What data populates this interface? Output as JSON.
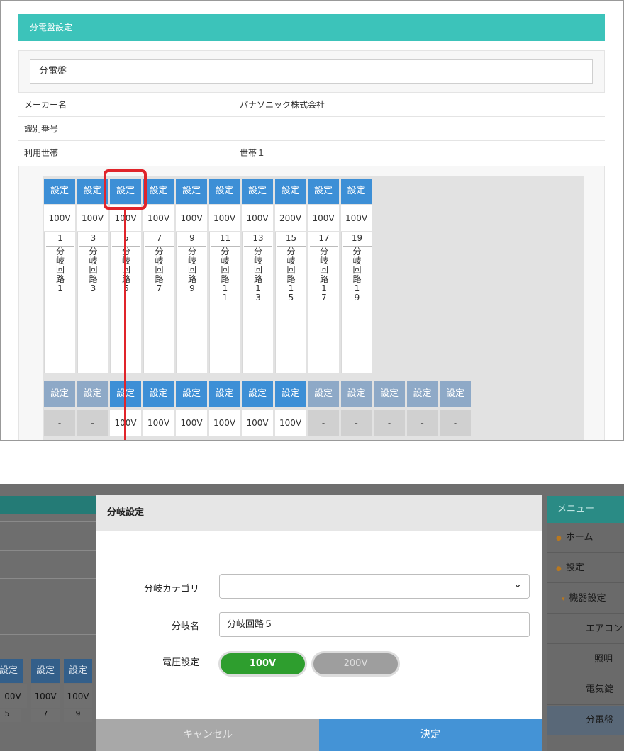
{
  "top": {
    "header_title": "分電盤設定",
    "board_name": "分電盤",
    "info_rows": [
      {
        "label": "メーカー名",
        "value": "パナソニック株式会社"
      },
      {
        "label": "識別番号",
        "value": ""
      },
      {
        "label": "利用世帯",
        "value": "世帯１"
      }
    ],
    "row1": [
      {
        "btn": "設定",
        "volt": "100V",
        "num": "1",
        "name": "分岐回路1"
      },
      {
        "btn": "設定",
        "volt": "100V",
        "num": "3",
        "name": "分岐回路3"
      },
      {
        "btn": "設定",
        "volt": "100V",
        "num": "5",
        "name": "分岐回路5"
      },
      {
        "btn": "設定",
        "volt": "100V",
        "num": "7",
        "name": "分岐回路7"
      },
      {
        "btn": "設定",
        "volt": "100V",
        "num": "9",
        "name": "分岐回路9"
      },
      {
        "btn": "設定",
        "volt": "100V",
        "num": "11",
        "name": "分岐回路11"
      },
      {
        "btn": "設定",
        "volt": "100V",
        "num": "13",
        "name": "分岐回路13"
      },
      {
        "btn": "設定",
        "volt": "200V",
        "num": "15",
        "name": "分岐回路15"
      },
      {
        "btn": "設定",
        "volt": "100V",
        "num": "17",
        "name": "分岐回路17"
      },
      {
        "btn": "設定",
        "volt": "100V",
        "num": "19",
        "name": "分岐回路19"
      }
    ],
    "row2": [
      {
        "btn": "設定",
        "volt": "-",
        "active": false
      },
      {
        "btn": "設定",
        "volt": "-",
        "active": false
      },
      {
        "btn": "設定",
        "volt": "100V",
        "active": true
      },
      {
        "btn": "設定",
        "volt": "100V",
        "active": true
      },
      {
        "btn": "設定",
        "volt": "100V",
        "active": true
      },
      {
        "btn": "設定",
        "volt": "100V",
        "active": true
      },
      {
        "btn": "設定",
        "volt": "100V",
        "active": true
      },
      {
        "btn": "設定",
        "volt": "100V",
        "active": true
      },
      {
        "btn": "設定",
        "volt": "-",
        "active": false
      },
      {
        "btn": "設定",
        "volt": "-",
        "active": false
      },
      {
        "btn": "設定",
        "volt": "-",
        "active": false
      },
      {
        "btn": "設定",
        "volt": "-",
        "active": false
      },
      {
        "btn": "設定",
        "volt": "-",
        "active": false
      }
    ]
  },
  "bottom": {
    "bg_buttons": [
      "設定",
      "設定",
      "設定"
    ],
    "bg_volts": [
      "00V",
      "100V",
      "100V"
    ],
    "bg_nums": [
      "5",
      "7",
      "9"
    ],
    "menu": {
      "title": "メニュー",
      "items": [
        {
          "label": "ホーム",
          "icon": "home-icon"
        },
        {
          "label": "設定",
          "icon": "gear-icon"
        },
        {
          "label": "機器設定",
          "icon": "chevron-down-icon"
        },
        {
          "label": "エアコン",
          "icon": ""
        },
        {
          "label": "照明",
          "icon": ""
        },
        {
          "label": "電気錠",
          "icon": ""
        },
        {
          "label": "分電盤",
          "icon": ""
        }
      ]
    },
    "modal": {
      "title": "分岐設定",
      "category_label": "分岐カテゴリ",
      "category_value": "",
      "name_label": "分岐名",
      "name_value": "分岐回路５",
      "voltage_label": "電圧設定",
      "voltage_options": [
        "100V",
        "200V"
      ],
      "voltage_selected": "100V",
      "cancel_label": "キャンセル",
      "ok_label": "決定"
    }
  },
  "colors": {
    "header_teal": "#3cc3ba",
    "button_blue": "#3d8fd6",
    "button_disabled": "#8ea9c7",
    "highlight_red": "#e0242a",
    "voltage_green": "#2e9e2e",
    "ok_blue": "#4493d6"
  }
}
